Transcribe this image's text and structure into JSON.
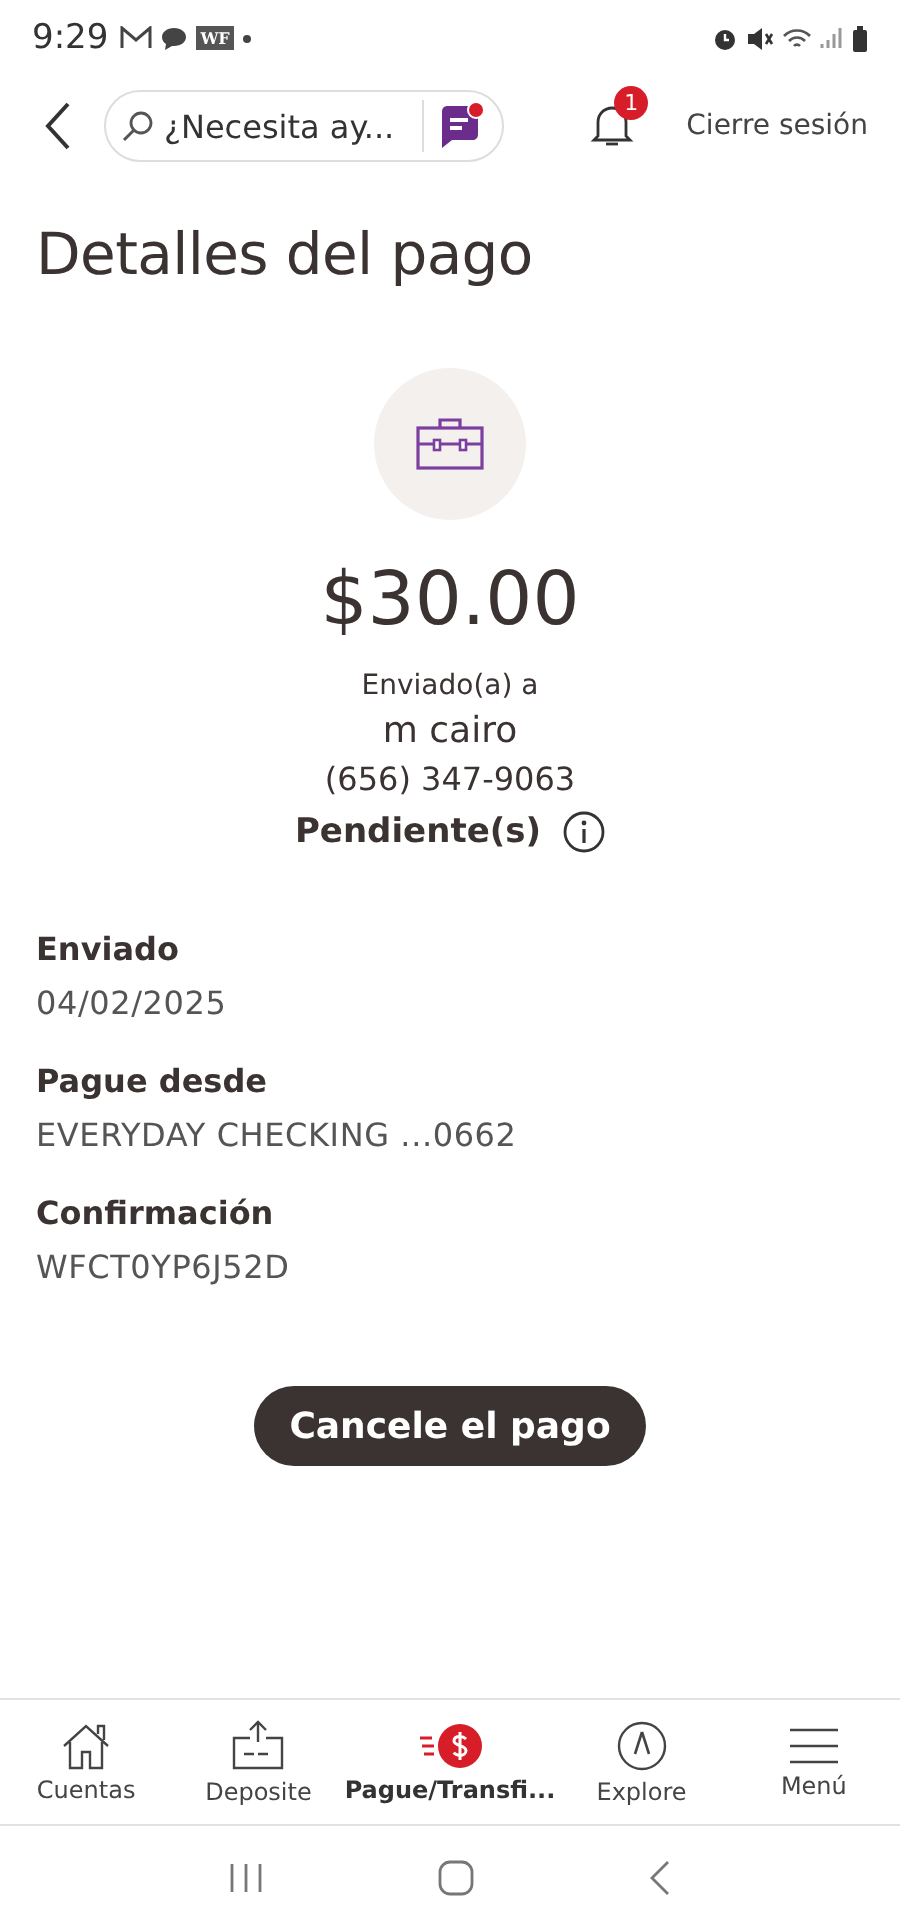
{
  "status_bar": {
    "time": "9:29",
    "app_badge": "WF"
  },
  "header": {
    "search": {
      "placeholder": "¿Necesita ay..."
    },
    "notifications": {
      "count": "1"
    },
    "logout": "Cierre sesión"
  },
  "title": "Detalles del pago",
  "payment": {
    "amount": "$30.00",
    "sent_to_label": "Enviado(a) a",
    "recipient": "m cairo",
    "phone": "(656) 347-9063",
    "status": "Pendiente(s)"
  },
  "details": [
    {
      "label": "Enviado",
      "value": "04/02/2025"
    },
    {
      "label": "Pague desde",
      "value": "EVERYDAY CHECKING ...0662"
    },
    {
      "label": "Confirmación",
      "value": "WFCT0YP6J52D"
    }
  ],
  "cancel_button": "Cancele el pago",
  "bottom_nav": [
    {
      "kind": "home",
      "label": "Cuentas",
      "selected": false
    },
    {
      "kind": "deposit",
      "label": "Deposite",
      "selected": false
    },
    {
      "kind": "pay",
      "label": "Pague/Transfi...",
      "selected": true
    },
    {
      "kind": "explore",
      "label": "Explore",
      "selected": false
    },
    {
      "kind": "menu",
      "label": "Menú",
      "selected": false
    }
  ]
}
